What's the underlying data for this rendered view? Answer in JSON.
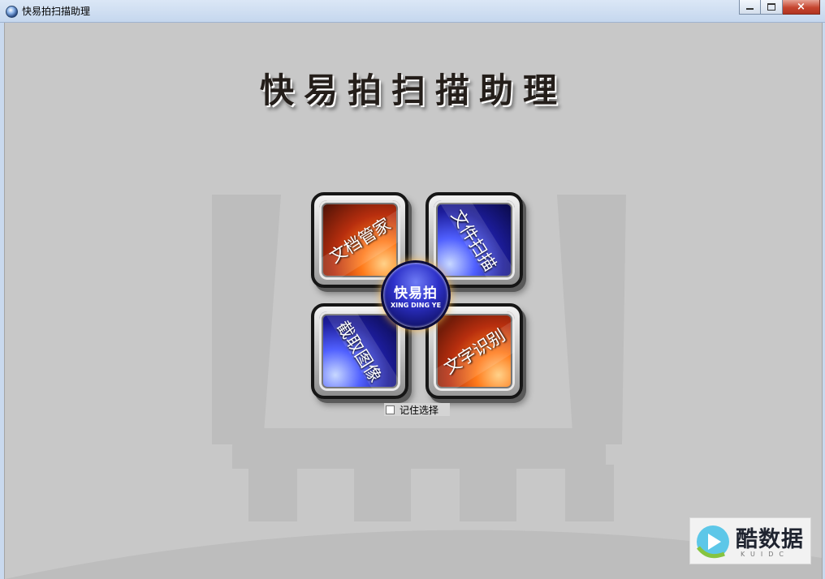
{
  "window": {
    "title": "快易拍扫描助理",
    "buttons": {
      "minimize": "minimize-icon",
      "maximize": "maximize-icon",
      "close": "×"
    }
  },
  "header": {
    "title": "快易拍扫描助理"
  },
  "tiles": [
    {
      "label": "文档管家",
      "style": "orange"
    },
    {
      "label": "文件扫描",
      "style": "blue"
    },
    {
      "label": "截取图像",
      "style": "blue"
    },
    {
      "label": "文字识别",
      "style": "orange"
    }
  ],
  "logo": {
    "main": "快易拍",
    "sub": "XING DING YE"
  },
  "remember_choice": {
    "label": "记住选择",
    "checked": false
  },
  "watermark": {
    "text": "酷数据",
    "sub": "KUIDC"
  },
  "colors": {
    "background": "#c8c8c8",
    "orange_tile": "#c5451a",
    "blue_tile": "#2b2fc4",
    "title_text": "#241e1a"
  }
}
